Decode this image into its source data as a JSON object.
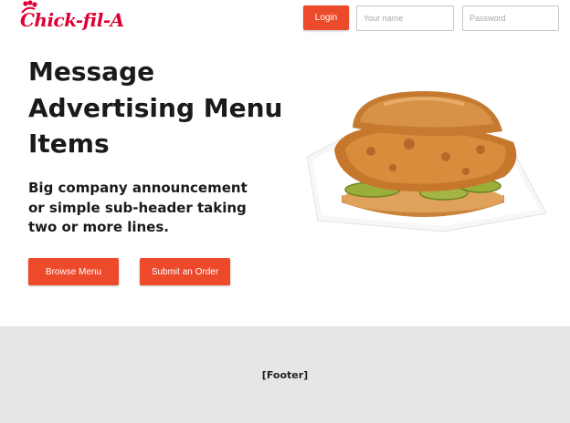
{
  "brand": {
    "logo_text": "Chick-fil-A",
    "color": "#dd0033"
  },
  "header": {
    "login_label": "Login",
    "name_placeholder": "Your name",
    "password_placeholder": "Password"
  },
  "hero": {
    "headline": "Message Advertising Menu Items",
    "subheader": "Big company announcement or simple sub-header taking two or more lines.",
    "browse_label": "Browse Menu",
    "order_label": "Submit an Order",
    "image": "chicken-sandwich"
  },
  "footer": {
    "label": "[Footer]"
  },
  "colors": {
    "accent": "#ec4a2b",
    "footer_bg": "#e6e6e6"
  }
}
